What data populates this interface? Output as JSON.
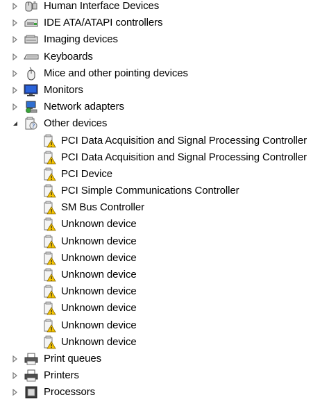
{
  "device_tree": {
    "top_categories": [
      {
        "label": "Human Interface Devices",
        "icon": "hid-icon",
        "expanded": false
      },
      {
        "label": "IDE ATA/ATAPI controllers",
        "icon": "ide-controller-icon",
        "expanded": false
      },
      {
        "label": "Imaging devices",
        "icon": "imaging-device-icon",
        "expanded": false
      },
      {
        "label": "Keyboards",
        "icon": "keyboard-icon",
        "expanded": false
      },
      {
        "label": "Mice and other pointing devices",
        "icon": "mouse-icon",
        "expanded": false
      },
      {
        "label": "Monitors",
        "icon": "monitor-icon",
        "expanded": false
      },
      {
        "label": "Network adapters",
        "icon": "network-adapter-icon",
        "expanded": false
      },
      {
        "label": "Other devices",
        "icon": "unknown-device-category-icon",
        "expanded": true
      }
    ],
    "other_devices": [
      {
        "label": "PCI Data Acquisition and Signal Processing Controller",
        "icon": "warning-device-icon"
      },
      {
        "label": "PCI Data Acquisition and Signal Processing Controller",
        "icon": "warning-device-icon"
      },
      {
        "label": "PCI Device",
        "icon": "warning-device-icon"
      },
      {
        "label": "PCI Simple Communications Controller",
        "icon": "warning-device-icon"
      },
      {
        "label": "SM Bus Controller",
        "icon": "warning-device-icon"
      },
      {
        "label": "Unknown device",
        "icon": "warning-device-icon"
      },
      {
        "label": "Unknown device",
        "icon": "warning-device-icon"
      },
      {
        "label": "Unknown device",
        "icon": "warning-device-icon"
      },
      {
        "label": "Unknown device",
        "icon": "warning-device-icon"
      },
      {
        "label": "Unknown device",
        "icon": "warning-device-icon"
      },
      {
        "label": "Unknown device",
        "icon": "warning-device-icon"
      },
      {
        "label": "Unknown device",
        "icon": "warning-device-icon"
      },
      {
        "label": "Unknown device",
        "icon": "warning-device-icon"
      }
    ],
    "bottom_categories": [
      {
        "label": "Print queues",
        "icon": "print-queue-icon",
        "expanded": false
      },
      {
        "label": "Printers",
        "icon": "printer-icon",
        "expanded": false
      },
      {
        "label": "Processors",
        "icon": "processor-icon",
        "expanded": false
      }
    ]
  },
  "colors": {
    "expander": "#7a7a7a",
    "warning": "#f5c400",
    "device_outline": "#8a6a00",
    "text": "#000000"
  }
}
